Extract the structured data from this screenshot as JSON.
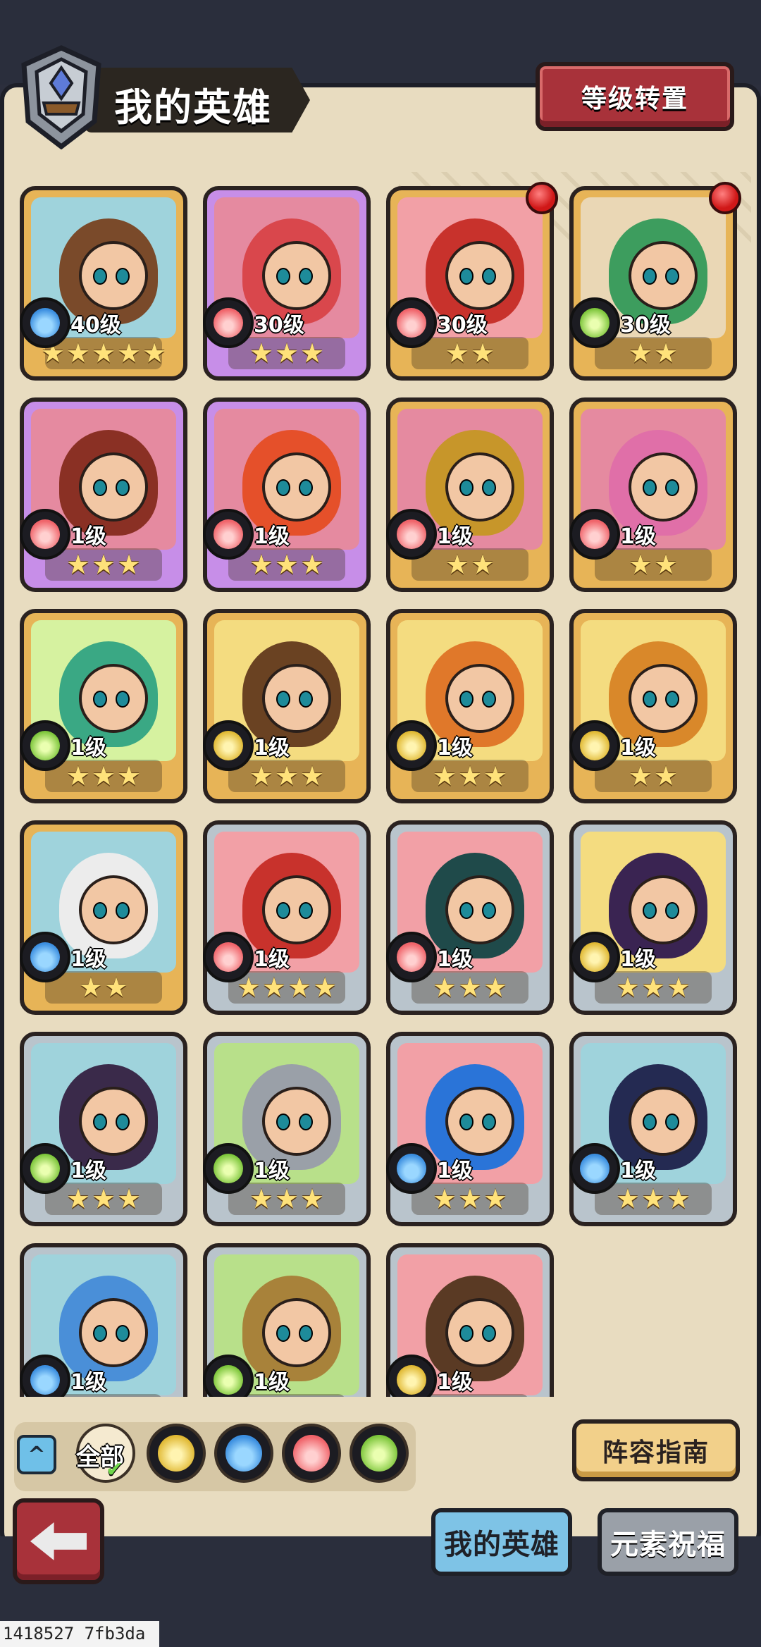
{
  "header": {
    "title": "我的英雄",
    "level_reset_label": "等级转置"
  },
  "heroes": [
    {
      "level": "40级",
      "stars": 5,
      "element": "water",
      "rarity": "gold",
      "red_dot": false,
      "palette": [
        "#9fd3dc",
        "#7a4a2a"
      ]
    },
    {
      "level": "30级",
      "stars": 3,
      "element": "fire",
      "rarity": "purple",
      "red_dot": false,
      "palette": [
        "#e58aa0",
        "#d9474c"
      ]
    },
    {
      "level": "30级",
      "stars": 2,
      "element": "fire",
      "rarity": "gold",
      "red_dot": true,
      "palette": [
        "#f2a0a6",
        "#c8322c"
      ]
    },
    {
      "level": "30级",
      "stars": 2,
      "element": "wind",
      "rarity": "gold",
      "red_dot": true,
      "palette": [
        "#ead7b5",
        "#3d9d5e"
      ]
    },
    {
      "level": "1级",
      "stars": 3,
      "element": "fire",
      "rarity": "purple",
      "red_dot": false,
      "palette": [
        "#e58aa0",
        "#8a3024"
      ]
    },
    {
      "level": "1级",
      "stars": 3,
      "element": "fire",
      "rarity": "purple",
      "red_dot": false,
      "palette": [
        "#e58aa0",
        "#e5502a"
      ]
    },
    {
      "level": "1级",
      "stars": 2,
      "element": "fire",
      "rarity": "gold",
      "red_dot": false,
      "palette": [
        "#e58aa0",
        "#c7962a"
      ]
    },
    {
      "level": "1级",
      "stars": 2,
      "element": "fire",
      "rarity": "gold",
      "red_dot": false,
      "palette": [
        "#e58aa0",
        "#e06fa8"
      ]
    },
    {
      "level": "1级",
      "stars": 3,
      "element": "wind",
      "rarity": "gold",
      "red_dot": false,
      "palette": [
        "#d6f2a0",
        "#3aa884"
      ]
    },
    {
      "level": "1级",
      "stars": 3,
      "element": "earth",
      "rarity": "gold",
      "red_dot": false,
      "palette": [
        "#f4dc80",
        "#6a4222"
      ]
    },
    {
      "level": "1级",
      "stars": 3,
      "element": "earth",
      "rarity": "gold",
      "red_dot": false,
      "palette": [
        "#f4dc80",
        "#e0782a"
      ]
    },
    {
      "level": "1级",
      "stars": 2,
      "element": "earth",
      "rarity": "gold",
      "red_dot": false,
      "palette": [
        "#f4dc80",
        "#d9882a"
      ]
    },
    {
      "level": "1级",
      "stars": 2,
      "element": "water",
      "rarity": "gold",
      "red_dot": false,
      "palette": [
        "#9fd3dc",
        "#ececec"
      ]
    },
    {
      "level": "1级",
      "stars": 4,
      "element": "fire",
      "rarity": "silver",
      "red_dot": false,
      "palette": [
        "#f2a0a6",
        "#c8322c"
      ]
    },
    {
      "level": "1级",
      "stars": 3,
      "element": "fire",
      "rarity": "silver",
      "red_dot": false,
      "palette": [
        "#f2a0a6",
        "#1f4a4a"
      ]
    },
    {
      "level": "1级",
      "stars": 3,
      "element": "earth",
      "rarity": "silver",
      "red_dot": false,
      "palette": [
        "#f4dc80",
        "#3a2452"
      ]
    },
    {
      "level": "1级",
      "stars": 3,
      "element": "wind",
      "rarity": "silver",
      "red_dot": false,
      "palette": [
        "#9fd3dc",
        "#3a2a4a"
      ]
    },
    {
      "level": "1级",
      "stars": 3,
      "element": "wind",
      "rarity": "silver",
      "red_dot": false,
      "palette": [
        "#b8e08a",
        "#9aa0a8"
      ]
    },
    {
      "level": "1级",
      "stars": 3,
      "element": "water",
      "rarity": "silver",
      "red_dot": false,
      "palette": [
        "#f2a0a6",
        "#2a74d8"
      ]
    },
    {
      "level": "1级",
      "stars": 3,
      "element": "water",
      "rarity": "silver",
      "red_dot": false,
      "palette": [
        "#9fd3dc",
        "#242a52"
      ]
    },
    {
      "level": "1级",
      "stars": 0,
      "element": "water",
      "rarity": "silver",
      "red_dot": false,
      "palette": [
        "#9fd3dc",
        "#4a8fd8"
      ]
    },
    {
      "level": "1级",
      "stars": 0,
      "element": "wind",
      "rarity": "silver",
      "red_dot": false,
      "palette": [
        "#b8e08a",
        "#a8823a"
      ]
    },
    {
      "level": "1级",
      "stars": 0,
      "element": "earth",
      "rarity": "silver",
      "red_dot": false,
      "palette": [
        "#f2a0a6",
        "#5a3a24"
      ]
    }
  ],
  "filters": {
    "all_label": "全部",
    "items": [
      "all",
      "earth",
      "water",
      "fire",
      "wind"
    ]
  },
  "guide_label": "阵容指南",
  "tabs": {
    "my_heroes": "我的英雄",
    "element_blessing": "元素祝福"
  },
  "footer_id": "1418527 7fb3da",
  "colors": {
    "water": "#3c8fe0",
    "fire": "#f0646a",
    "wind": "#7cc53a",
    "earth": "#e0b832"
  }
}
